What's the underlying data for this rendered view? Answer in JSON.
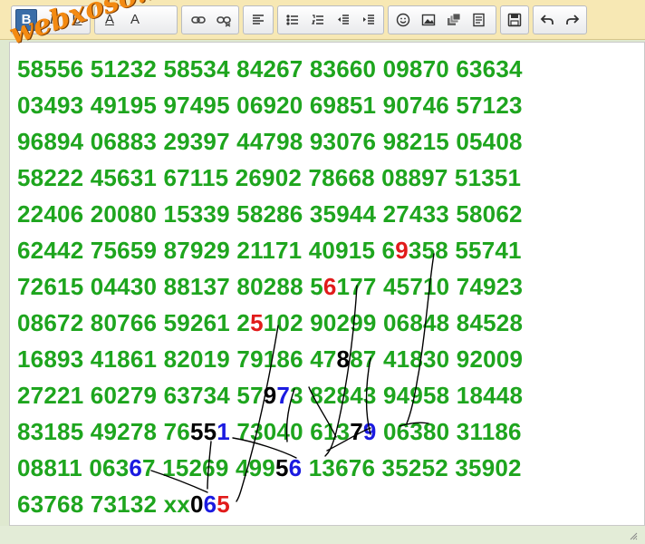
{
  "watermark": "webxoso.net",
  "toolbar": {
    "bold": "B",
    "italic": "I",
    "underline": "U",
    "font_color": "A",
    "font_size": "A"
  },
  "icons": [
    "bold-icon",
    "italic-icon",
    "underline-icon",
    "font-color-icon",
    "font-size-icon",
    "link-icon",
    "unlink-icon",
    "align-left-icon",
    "bullet-list-icon",
    "numbered-list-icon",
    "outdent-icon",
    "indent-icon",
    "emoticon-icon",
    "image-icon",
    "media-icon",
    "paste-icon",
    "save-icon",
    "undo-icon",
    "redo-icon"
  ],
  "colors": {
    "number_green": "#1ea51e",
    "highlight_red": "#e11b1b",
    "highlight_blue": "#1b1be0",
    "highlight_black": "#000000",
    "toolbar_bg": "#f7e8b4"
  },
  "lines": [
    "58556 51232 58534 84267 83660 09870 63634",
    "03493 49195 97495 06920 69851 90746 57123",
    "96894 06883 29397 44798 93076 98215 05408",
    "58222 45631 67115 26902 78668 08897 51351",
    "22406 20080 15339 58286 35944 27433 58062",
    "62442 75659 87929 21171 40915 69358 55741",
    "72615 04430 88137 80288 56177 45710 74923",
    "08672 80766 59261 25102 90299 06848 84528",
    "16893 41861 82019 79186 47887 41830 92009",
    "27221 60279 63734 57973 82843 94958 18448",
    "83185 49278 76551 73040 61379 06380 31186",
    "08811 06367 15269 49956 13676 35252 35902",
    "63768 73132 xx065"
  ]
}
